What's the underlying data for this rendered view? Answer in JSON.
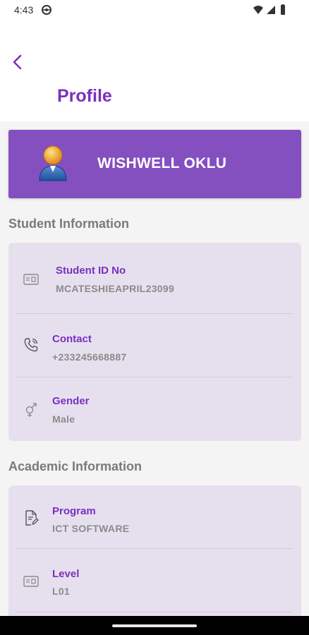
{
  "status_bar": {
    "time": "4:43"
  },
  "header": {
    "title": "Profile"
  },
  "profile": {
    "name": "WISHWELL OKLU"
  },
  "student_section": {
    "title": "Student Information",
    "items": [
      {
        "label": "Student ID No",
        "value": "MCATESHIEAPRIL23099",
        "icon": "id-card-icon"
      },
      {
        "label": "Contact",
        "value": "+233245668887",
        "icon": "phone-icon"
      },
      {
        "label": "Gender",
        "value": "Male",
        "icon": "gender-icon"
      }
    ]
  },
  "academic_section": {
    "title": "Academic Information",
    "items": [
      {
        "label": "Program",
        "value": "ICT SOFTWARE",
        "icon": "document-edit-icon"
      },
      {
        "label": "Level",
        "value": "L01",
        "icon": "id-card-icon"
      }
    ]
  },
  "colors": {
    "accent": "#7b2fbf",
    "card_header": "#8450c0",
    "card_bg": "#e6e0ee"
  }
}
